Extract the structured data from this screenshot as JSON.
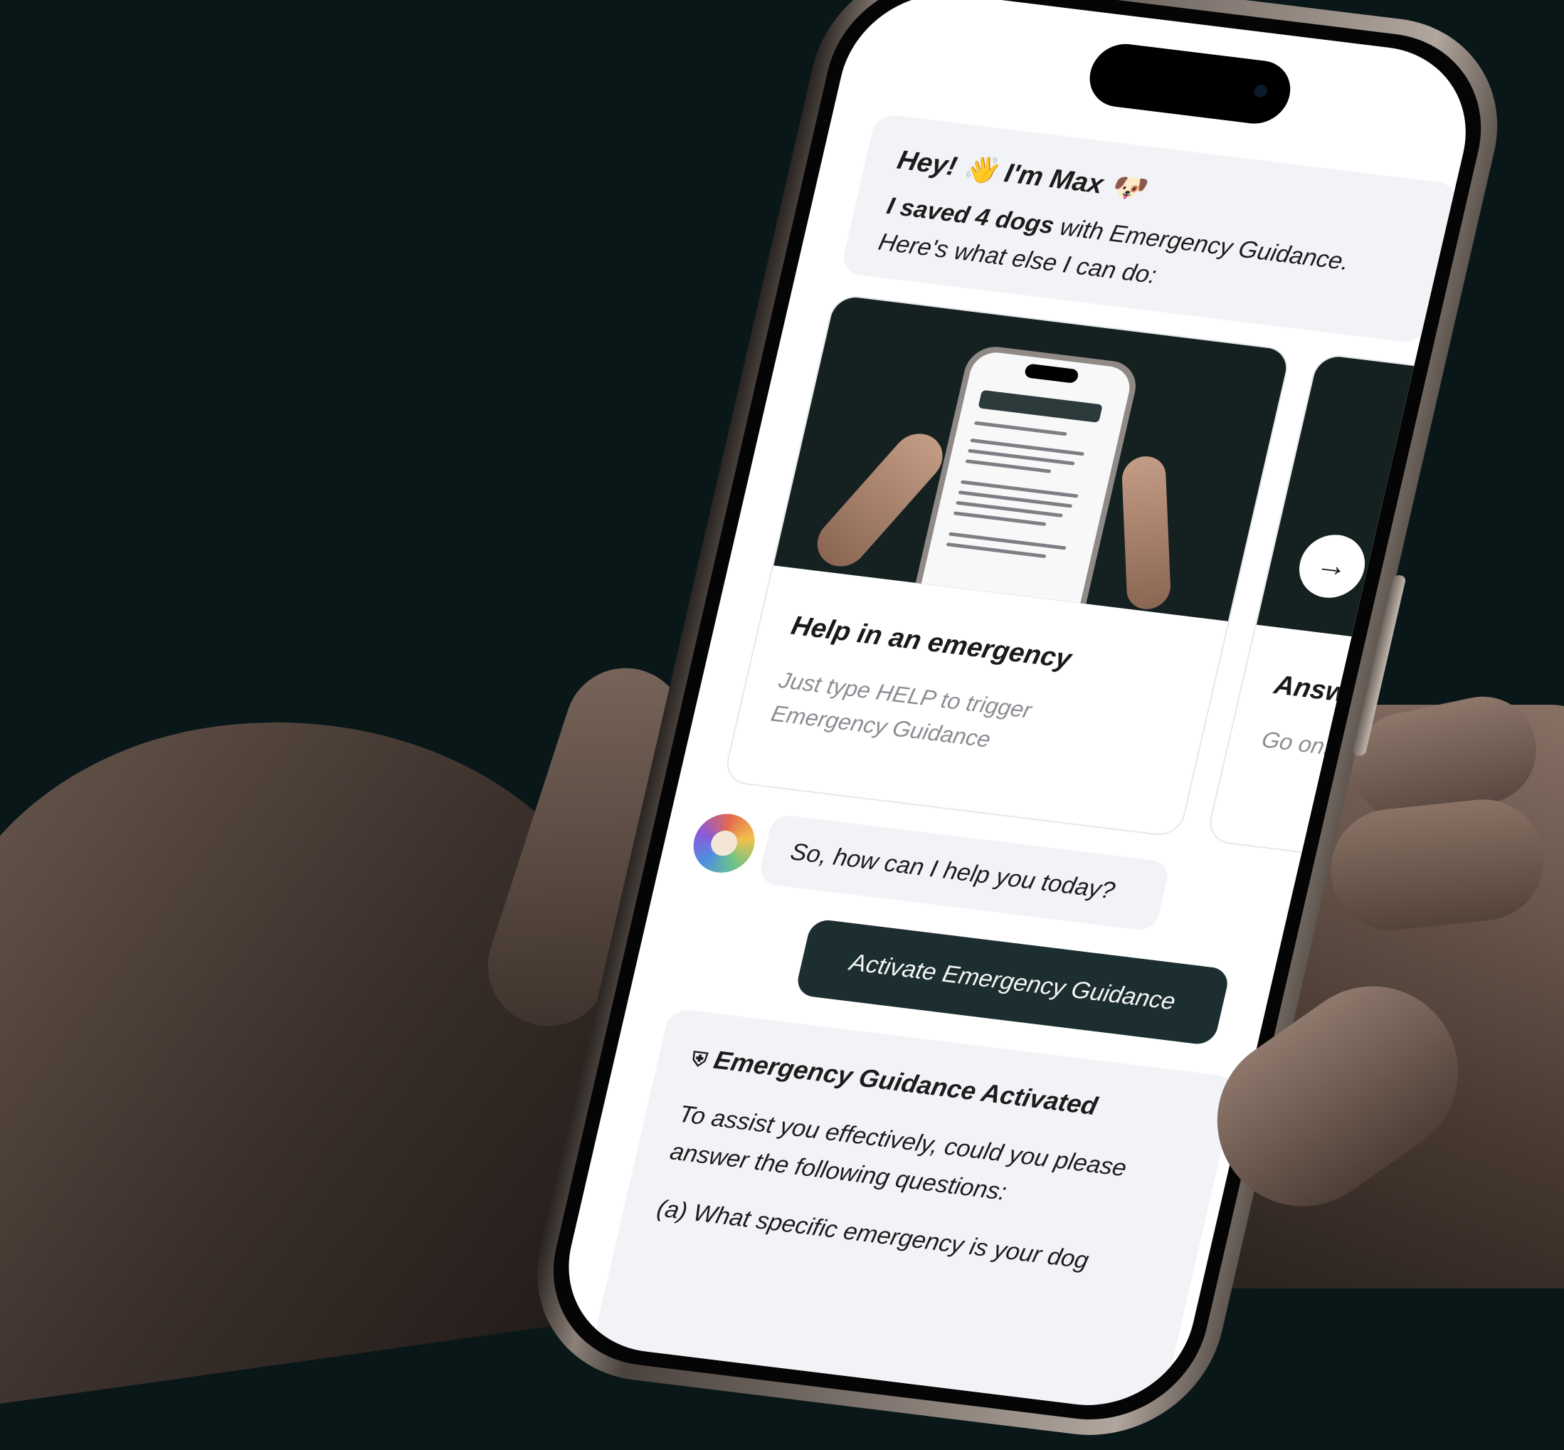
{
  "chat": {
    "greeting": "Hey! 👋 I'm Max 🐶",
    "intro_bold": "I saved 4 dogs",
    "intro_rest": "with Emergency Guidance.",
    "intro_line2": "Here's what else I can do:",
    "features": [
      {
        "title": "Help in an emergency",
        "description": "Just type HELP to trigger Emergency Guidance"
      },
      {
        "title": "Answer",
        "description": "Go on... can thin"
      }
    ],
    "bot_question": "So, how can I help you today?",
    "user_message": "Activate Emergency Guidance",
    "guidance": {
      "icon": "shield-icon",
      "title": "Emergency Guidance Activated",
      "body": "To assist you effectively, could you please answer the following questions:",
      "question": "(a) What specific emergency is your dog"
    }
  },
  "colors": {
    "background": "#0a1719",
    "bubble": "#f1f3f6",
    "user_bubble": "#1d2e30",
    "card_image_bg": "#152021"
  }
}
